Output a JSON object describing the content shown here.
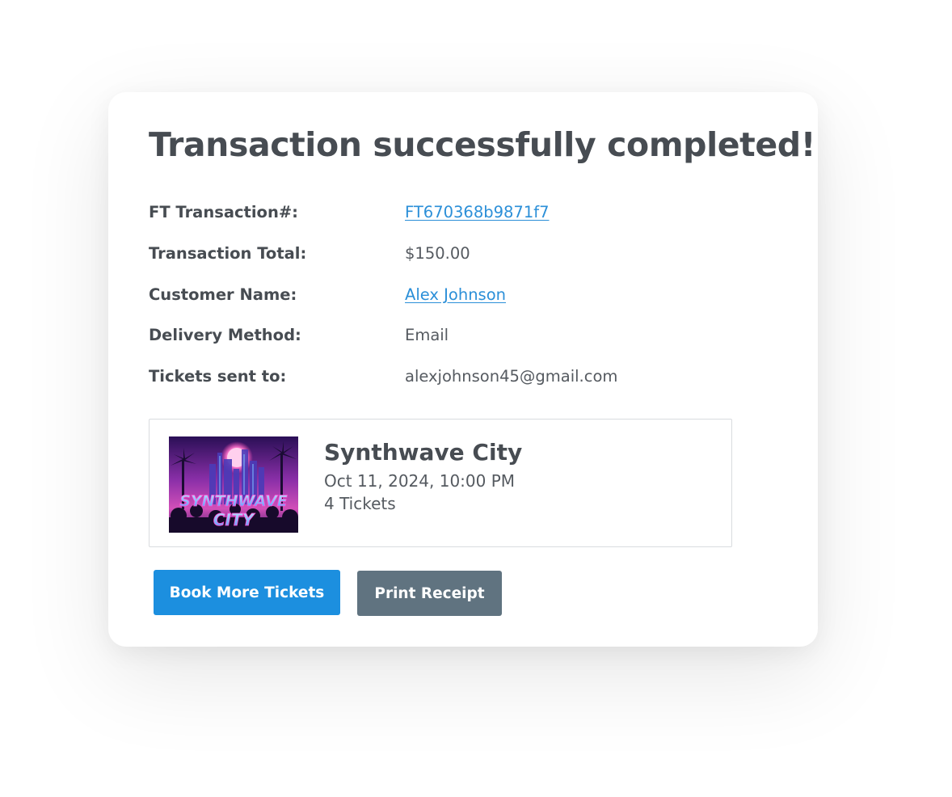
{
  "title": "Transaction successfully completed!",
  "details": [
    {
      "label": "FT Transaction#:",
      "value": "FT670368b9871f7",
      "is_link": true
    },
    {
      "label": "Transaction Total:",
      "value": "$150.00",
      "is_link": false
    },
    {
      "label": "Customer Name:",
      "value": "Alex Johnson",
      "is_link": true
    },
    {
      "label": "Delivery Method:",
      "value": "Email",
      "is_link": false
    },
    {
      "label": "Tickets sent to:",
      "value": "alexjohnson45@gmail.com",
      "is_link": false
    }
  ],
  "event": {
    "name": "Synthwave City",
    "date": "Oct 11, 2024, 10:00 PM",
    "tickets": "4 Tickets",
    "poster_text_line1": "SYNTHWAVE",
    "poster_text_line2": "CITY"
  },
  "buttons": {
    "book_more": "Book More Tickets",
    "print_receipt": "Print Receipt"
  },
  "colors": {
    "link": "#2b8fd8",
    "primary_button": "#1c8fdf",
    "secondary_button": "#607380",
    "text": "#474c52"
  }
}
